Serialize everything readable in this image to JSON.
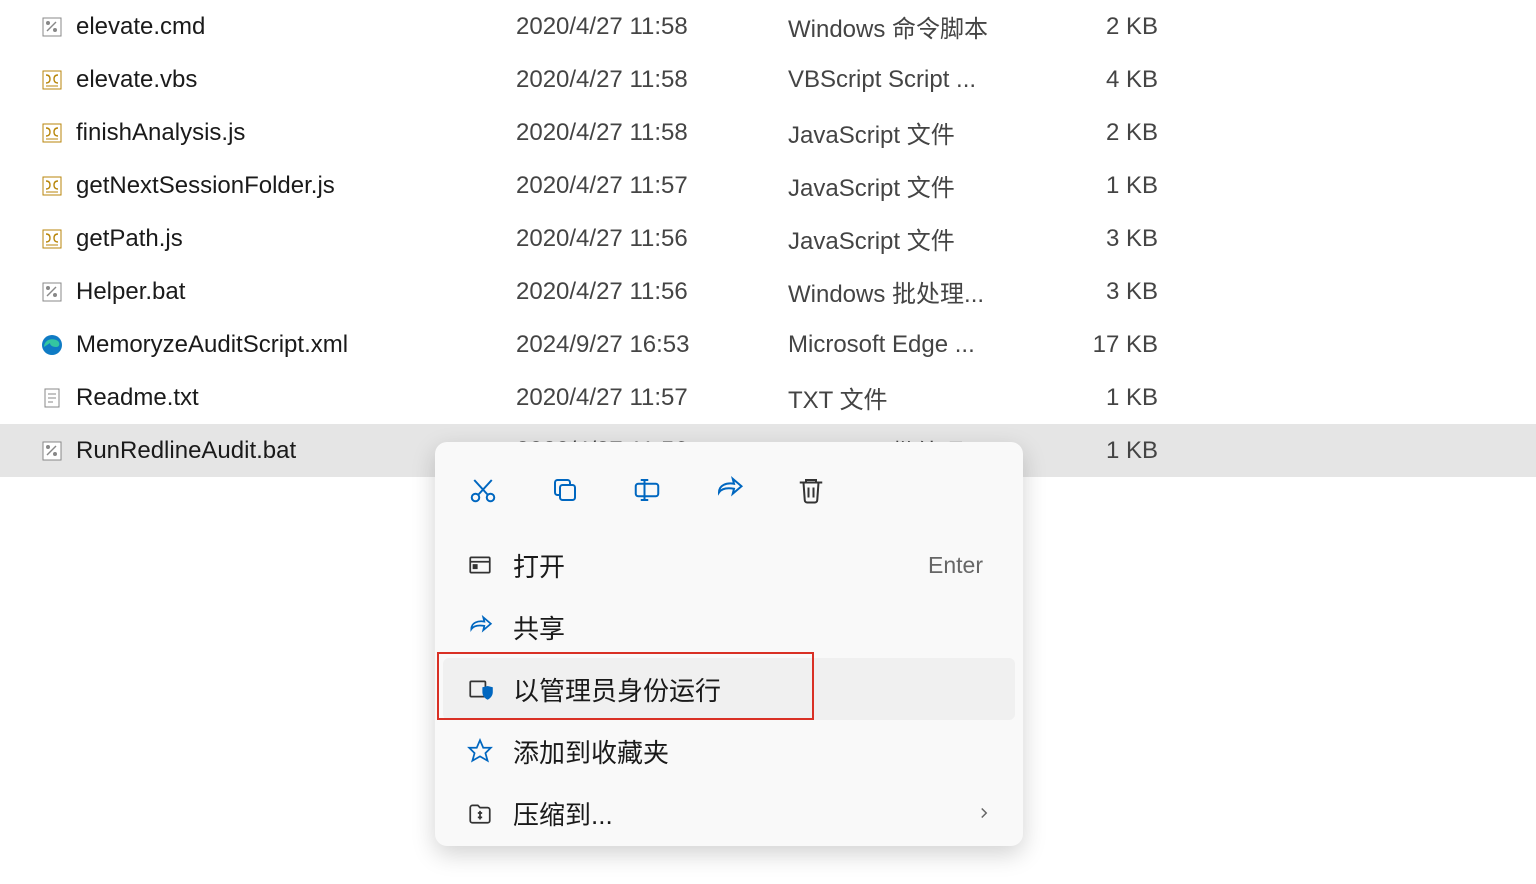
{
  "files": [
    {
      "name": "elevate.cmd",
      "date": "2020/4/27 11:58",
      "type": "Windows 命令脚本",
      "size": "2 KB",
      "icon": "batch"
    },
    {
      "name": "elevate.vbs",
      "date": "2020/4/27 11:58",
      "type": "VBScript Script ...",
      "size": "4 KB",
      "icon": "script"
    },
    {
      "name": "finishAnalysis.js",
      "date": "2020/4/27 11:58",
      "type": "JavaScript 文件",
      "size": "2 KB",
      "icon": "script"
    },
    {
      "name": "getNextSessionFolder.js",
      "date": "2020/4/27 11:57",
      "type": "JavaScript 文件",
      "size": "1 KB",
      "icon": "script"
    },
    {
      "name": "getPath.js",
      "date": "2020/4/27 11:56",
      "type": "JavaScript 文件",
      "size": "3 KB",
      "icon": "script"
    },
    {
      "name": "Helper.bat",
      "date": "2020/4/27 11:56",
      "type": "Windows 批处理...",
      "size": "3 KB",
      "icon": "batch"
    },
    {
      "name": "MemoryzeAuditScript.xml",
      "date": "2024/9/27 16:53",
      "type": "Microsoft Edge ...",
      "size": "17 KB",
      "icon": "edge"
    },
    {
      "name": "Readme.txt",
      "date": "2020/4/27 11:57",
      "type": "TXT 文件",
      "size": "1 KB",
      "icon": "txt"
    },
    {
      "name": "RunRedlineAudit.bat",
      "date": "2020/4/27 11:56",
      "type": "Windows 批处理...",
      "size": "1 KB",
      "icon": "batch",
      "selected": true
    }
  ],
  "context_menu": {
    "open": "打开",
    "open_hint": "Enter",
    "share": "共享",
    "run_as_admin": "以管理员身份运行",
    "add_to_favorites": "添加到收藏夹",
    "compress_to": "压缩到..."
  }
}
